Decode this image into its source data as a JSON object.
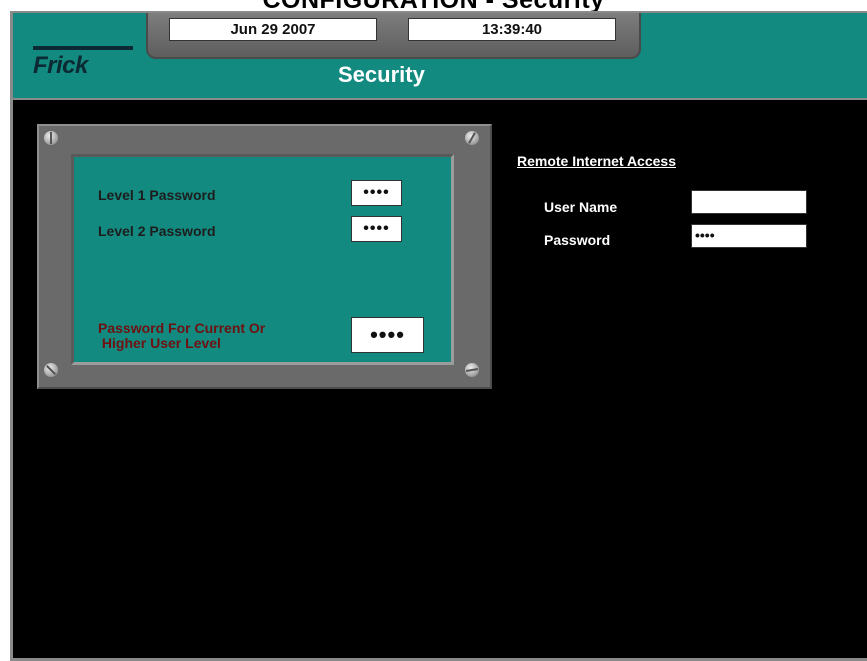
{
  "page_heading": "CONFIGURATION - Security",
  "header": {
    "date": "Jun 29 2007",
    "time": "13:39:40",
    "logo_text": "Frick",
    "title": "Security"
  },
  "password_panel": {
    "level1_label": "Level 1 Password",
    "level1_value": "••••",
    "level2_label": "Level 2 Password",
    "level2_value": "••••",
    "current_label_line1": "Password For Current Or",
    "current_label_line2": " Higher User Level",
    "current_value": "••••"
  },
  "remote_access": {
    "heading": "Remote Internet Access",
    "user_name_label": "User Name",
    "user_name_value": "",
    "password_label": "Password",
    "password_value": "••••"
  },
  "colors": {
    "teal": "#138a80",
    "bezel_gray": "#6a6a6a",
    "background": "#000000",
    "warning_text": "#6e1111"
  }
}
